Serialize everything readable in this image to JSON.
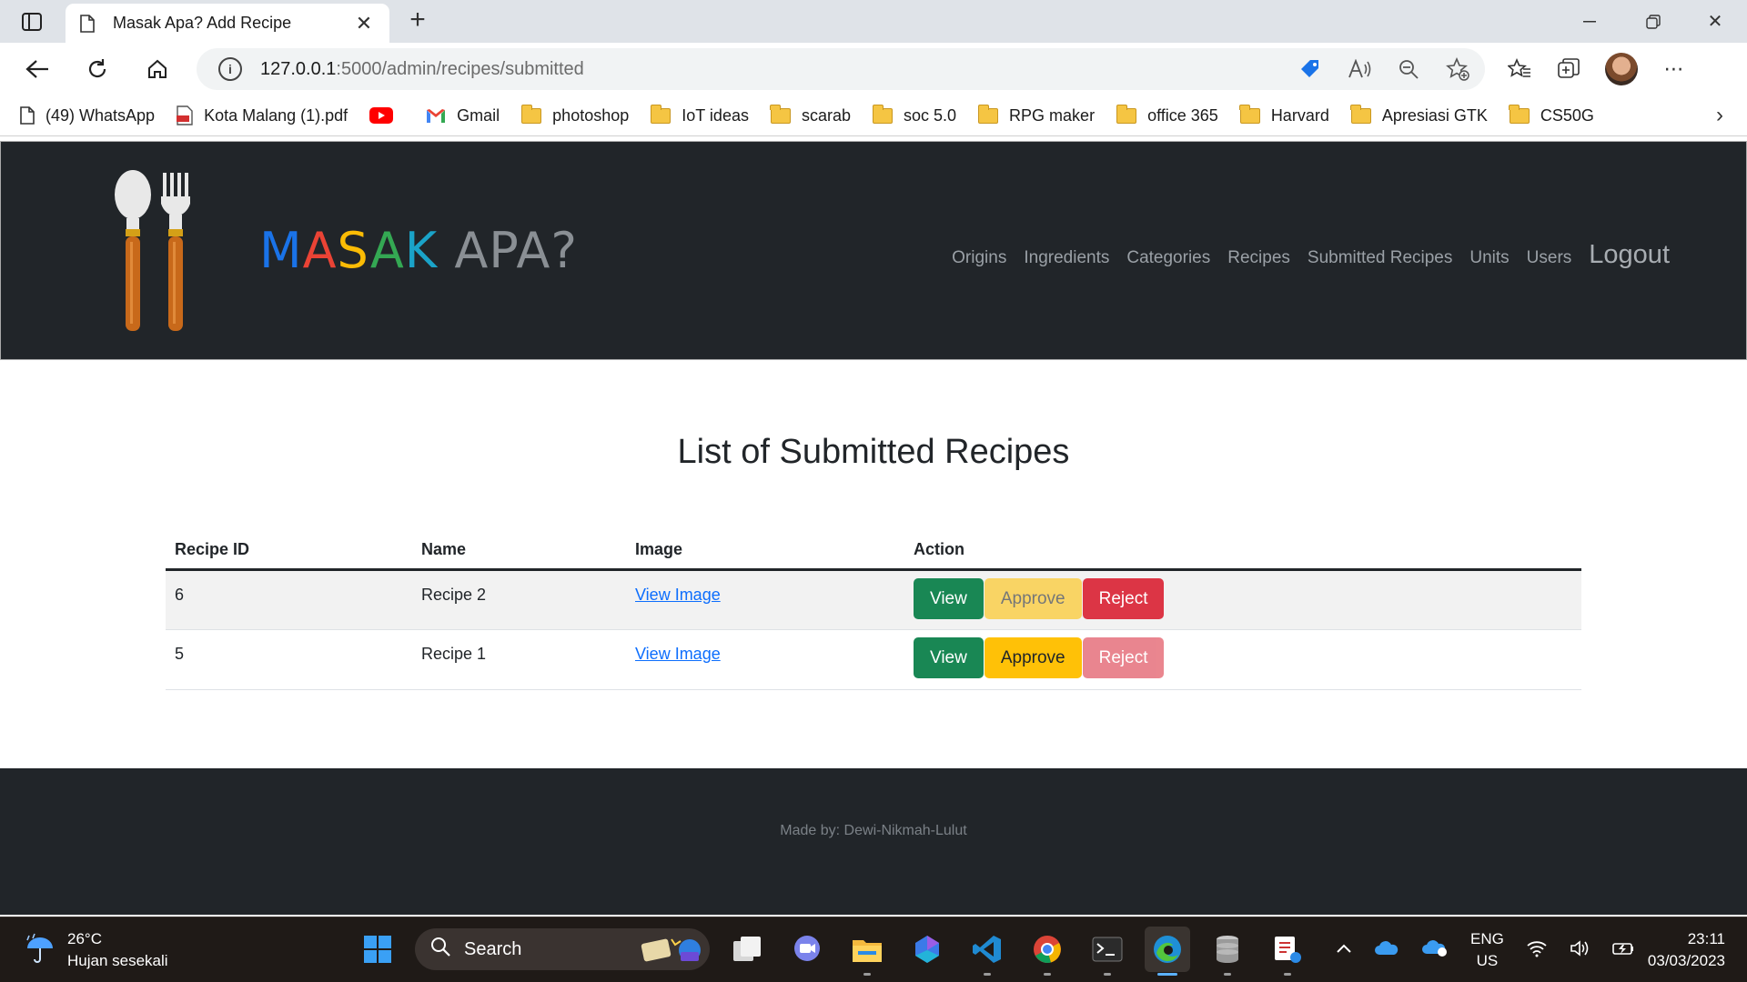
{
  "browser": {
    "tab_title": "Masak Apa? Add Recipe",
    "url_host": "127.0.0.1",
    "url_path": ":5000/admin/recipes/submitted",
    "bookmarks": [
      {
        "label": "(49) WhatsApp",
        "icon": "document-icon"
      },
      {
        "label": "Kota Malang (1).pdf",
        "icon": "pdf-icon"
      },
      {
        "label": "",
        "icon": "youtube-icon"
      },
      {
        "label": "Gmail",
        "icon": "gmail-icon"
      },
      {
        "label": "photoshop",
        "icon": "folder-icon"
      },
      {
        "label": "IoT ideas",
        "icon": "folder-icon"
      },
      {
        "label": "scarab",
        "icon": "folder-icon"
      },
      {
        "label": "soc 5.0",
        "icon": "folder-icon"
      },
      {
        "label": "RPG maker",
        "icon": "folder-icon"
      },
      {
        "label": "office 365",
        "icon": "folder-icon"
      },
      {
        "label": "Harvard",
        "icon": "folder-icon"
      },
      {
        "label": "Apresiasi GTK",
        "icon": "folder-icon"
      },
      {
        "label": "CS50G",
        "icon": "folder-icon"
      }
    ]
  },
  "site": {
    "brand": {
      "letters": [
        {
          "ch": "M",
          "color": "#1a73e8"
        },
        {
          "ch": "A",
          "color": "#ea4335"
        },
        {
          "ch": "S",
          "color": "#fbbc05"
        },
        {
          "ch": "A",
          "color": "#34a853"
        },
        {
          "ch": "K",
          "color": "#1aa3c8"
        }
      ],
      "rest": " APA?",
      "rest_color": "#8a8f94"
    },
    "nav": [
      "Origins",
      "Ingredients",
      "Categories",
      "Recipes",
      "Submitted Recipes",
      "Units",
      "Users"
    ],
    "logout": "Logout"
  },
  "main": {
    "title": "List of Submitted Recipes",
    "columns": [
      "Recipe ID",
      "Name",
      "Image",
      "Action"
    ],
    "rows": [
      {
        "id": "6",
        "name": "Recipe 2",
        "image_link": "View Image",
        "view": "View",
        "approve": "Approve",
        "reject": "Reject",
        "approve_disabled": true,
        "reject_disabled": false
      },
      {
        "id": "5",
        "name": "Recipe 1",
        "image_link": "View Image",
        "view": "View",
        "approve": "Approve",
        "reject": "Reject",
        "approve_disabled": false,
        "reject_disabled": true
      }
    ]
  },
  "footer": {
    "credit": "Made by: Dewi-Nikmah-Lulut"
  },
  "taskbar": {
    "temperature": "26°C",
    "weather": "Hujan sesekali",
    "search": "Search",
    "lang_top": "ENG",
    "lang_bottom": "US",
    "time": "23:11",
    "date": "03/03/2023"
  }
}
